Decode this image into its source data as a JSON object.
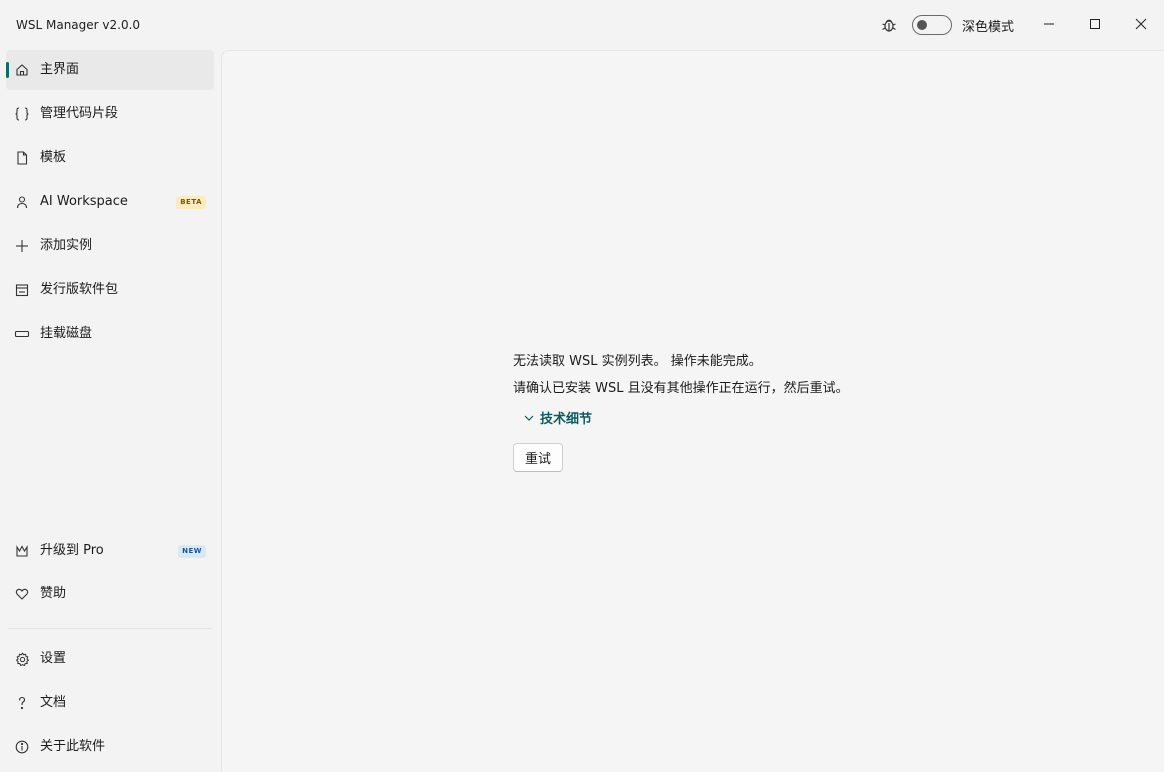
{
  "window": {
    "title": "WSL Manager v2.0.0",
    "dark_mode_label": "深色模式",
    "dark_mode_on": false
  },
  "sidebar": {
    "items": [
      {
        "label": "主界面",
        "icon": "home-icon",
        "active": true
      },
      {
        "label": "管理代码片段",
        "icon": "braces-icon"
      },
      {
        "label": "模板",
        "icon": "document-icon"
      },
      {
        "label": "AI Workspace",
        "icon": "person-icon",
        "badge": "BETA"
      },
      {
        "label": "添加实例",
        "icon": "plus-icon"
      },
      {
        "label": "发行版软件包",
        "icon": "store-icon"
      },
      {
        "label": "挂载磁盘",
        "icon": "disk-icon"
      }
    ],
    "promo": [
      {
        "label": "升级到 Pro",
        "icon": "crown-icon",
        "badge": "NEW"
      },
      {
        "label": "赞助",
        "icon": "heart-icon"
      }
    ],
    "footer": [
      {
        "label": "设置",
        "icon": "gear-icon"
      },
      {
        "label": "文档",
        "icon": "question-icon"
      },
      {
        "label": "关于此软件",
        "icon": "info-icon"
      }
    ]
  },
  "main": {
    "error_line1": "无法读取 WSL 实例列表。 操作未能完成。",
    "error_line2": "请确认已安装 WSL 且没有其他操作正在运行，然后重试。",
    "details_label": "技术细节",
    "retry_label": "重试"
  },
  "colors": {
    "accent": "#0f6a6a",
    "background": "#f3f3f3"
  }
}
